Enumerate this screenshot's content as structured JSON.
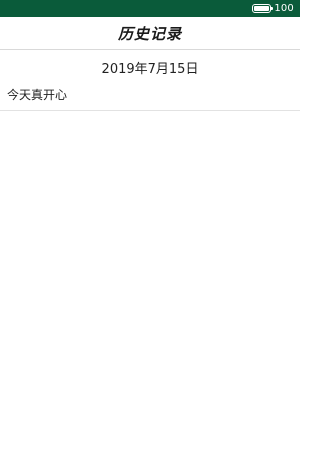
{
  "status_bar": {
    "battery_icon": "battery-icon",
    "battery_level": "100",
    "battery_fraction": 1.0,
    "background_color": "#0a5b3a"
  },
  "header": {
    "title": "历史记录"
  },
  "records": [
    {
      "date": "2019年7月15日",
      "text": "今天真开心"
    }
  ]
}
